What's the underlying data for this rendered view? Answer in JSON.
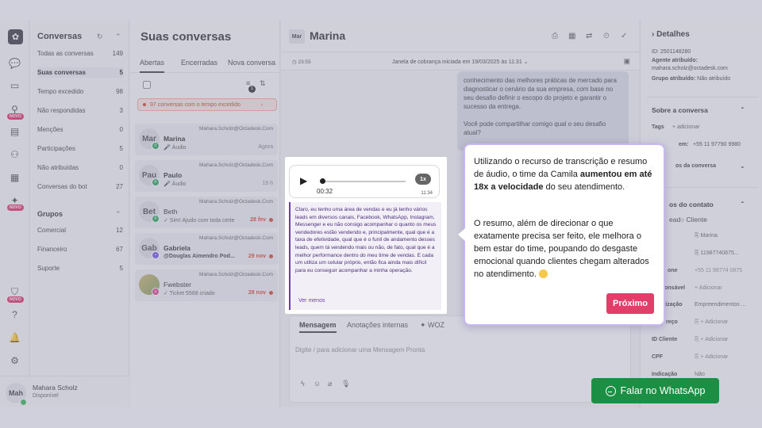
{
  "nav": {
    "title": "Conversas",
    "items": [
      {
        "label": "Todas as conversas",
        "count": "149"
      },
      {
        "label": "Suas conversas",
        "count": "5"
      },
      {
        "label": "Tempo excedido",
        "count": "98"
      },
      {
        "label": "Não respondidas",
        "count": "3"
      },
      {
        "label": "Menções",
        "count": "0"
      },
      {
        "label": "Participações",
        "count": "5"
      },
      {
        "label": "Não atribuídas",
        "count": "0"
      },
      {
        "label": "Conversas do bot",
        "count": "27"
      }
    ],
    "groups_title": "Grupos",
    "groups": [
      {
        "label": "Comercial",
        "count": "12"
      },
      {
        "label": "Financeiro",
        "count": "67"
      },
      {
        "label": "Suporte",
        "count": "5"
      }
    ],
    "novo_badge": "NOVO"
  },
  "user": {
    "initials": "Mah",
    "name": "Mahara Scholz",
    "status": "Disponível"
  },
  "conversations": {
    "title": "Suas conversas",
    "tabs": [
      "Abertas",
      "Encerradas",
      "Nova conversa"
    ],
    "alert": "97 conversas com o tempo excedido",
    "filter_badge": "1",
    "rows": [
      {
        "initials": "Mar",
        "email": "Mahara.Scholz@Octadesk.Com",
        "name": "Marina",
        "msg": "🎤 Áudio",
        "time": "Agora"
      },
      {
        "initials": "Pau",
        "email": "Mahara.Scholz@Octadesk.Com",
        "name": "Paulo",
        "msg": "🎤 Áudio",
        "time": "19 h"
      },
      {
        "initials": "Bet",
        "email": "Mahara.Scholz@Octadesk.Com",
        "name": "Beth",
        "msg": "✓ Sim! Ajudo com toda certe",
        "time": "28 fev"
      },
      {
        "initials": "Gab",
        "email": "Mahara.Scholz@Octadesk.Com",
        "name": "Gabriela",
        "msg": "@Douglas Aimendro Pod...",
        "time": "29 nov"
      },
      {
        "initials": "",
        "email": "Mahara.Scholz@Octadesk.Com",
        "name": "Fwebster",
        "msg": "✓ Ticket 5568 criado",
        "time": "28 nov"
      }
    ]
  },
  "chat": {
    "initials": "Mar",
    "name": "Marina",
    "timer": "23:55",
    "cobranca": "Janela de cobrança iniciada em 19/03/2025 às 11:31",
    "agent_msg_1": "conhecimento das melhores práticas de mercado para diagnosticar o cenário da sua empresa, com base no seu desafio definir o escopo do projeto e garantir o sucesso da entrega.",
    "agent_msg_2": "Você pode compartilhar comigo qual o seu desafio atual?",
    "compose_tabs": [
      "Mensagem",
      "Anotações internas",
      "WOZ"
    ],
    "placeholder": "Digite / para adicionar uma Mensagem Pronta"
  },
  "audio": {
    "duration": "00:32",
    "speed": "1x",
    "sent_time": "11:34",
    "progress": 0.02,
    "transcript": "Claro, eu tenho uma área de vendas e eu já tenho vários leads em diversos canais, Facebook, WhatsApp, Instagram, Messenger e eu não consigo acompanhar o quanto os meus vendedores estão vendendo e, principalmente, qual que é a taxa de efetividade, qual que é o funil de andamento desses leads, quem tá vendendo mais ou não, de fato, qual que é a melhor performance dentro do meu time de vendas. E cada um utiliza um celular próprio, então fica ainda mais difícil para eu conseguir acompanhar a minha operação.",
    "ver_menos": "Ver menos"
  },
  "tooltip": {
    "p1_a": "Utilizando o recurso de transcrição e resumo de áudio, o time da Camila ",
    "p1_bold": "aumentou em até 18x a velocidade",
    "p1_b": " do seu atendimento.",
    "p2": "O resumo, além de direcionar o que exatamente precisa ser feito, ele melhora o bem estar do time, poupando do desgaste emocional quando clientes chegam alterados no atendimento.",
    "button": "Próximo"
  },
  "details": {
    "title": "Detalhes",
    "id": "ID: 2501148280",
    "agent_label": "Agente atribuído:",
    "agent_value": "mahara.scholz@octadesk.com",
    "group_label": "Grupo atribuído:",
    "group_value": "Não atribuído",
    "about": "Sobre a conversa",
    "tags": "Tags",
    "add_tag": "+ adicionar",
    "phone_frag": "em:",
    "phone": "+55 11 97790 9980",
    "dados_frag": "os da conversa",
    "contact_frag": "os do contato",
    "lead_frag": "ead",
    "cliente": "Cliente",
    "name_value": "Marina",
    "phone2": "11987740875...",
    "phone_label_frag": "one",
    "phone3": "+55 11 98774 0875",
    "resp_frag": "onsável",
    "resp_value": "+ Adicionar",
    "org_frag": "nização",
    "org_value": "Empreendimentos ...",
    "end_frag": "reço",
    "add": "+ Adicionar",
    "id_cliente": "ID Cliente",
    "cpf": "CPF",
    "indicacao": "Indicação",
    "indicacao_value": "Não"
  },
  "whatsapp_button": "Falar no WhatsApp",
  "colors": {
    "accent": "#e53d6a",
    "whatsapp": "#1b8f43",
    "transcript": "#6a3fb3"
  }
}
